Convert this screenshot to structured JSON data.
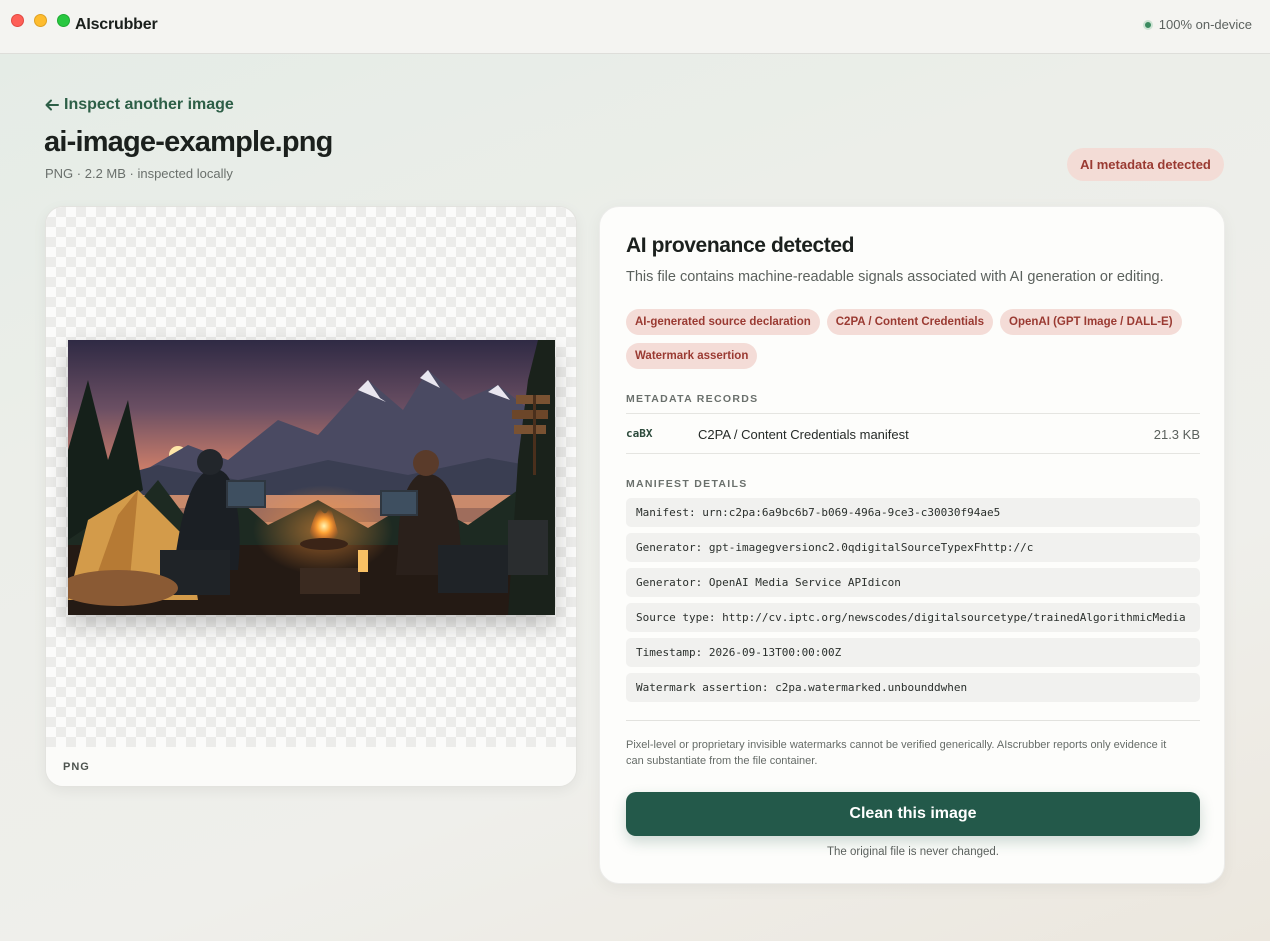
{
  "app": {
    "title": "AIscrubber",
    "status": "100% on-device"
  },
  "header": {
    "back_link": "Inspect another image",
    "back_icon": "arrow-left-icon",
    "file_name": "ai-image-example.png",
    "file_meta": "PNG · 2.2 MB · inspected locally",
    "badge": "AI metadata detected"
  },
  "preview": {
    "format_label": "PNG"
  },
  "analysis": {
    "title": "AI provenance detected",
    "subtitle": "This file contains machine-readable signals associated with AI generation or editing.",
    "chips": [
      "AI-generated source declaration",
      "C2PA / Content Credentials",
      "OpenAI (GPT Image / DALL-E)",
      "Watermark assertion"
    ],
    "records_label": "METADATA RECORDS",
    "records": [
      {
        "tag": "caBX",
        "name": "C2PA / Content Credentials manifest",
        "size": "21.3 KB"
      }
    ],
    "details_label": "MANIFEST DETAILS",
    "details": [
      "Manifest: urn:c2pa:6a9bc6b7-b069-496a-9ce3-c30030f94ae5",
      "Generator: gpt-imagegversionc2.0qdigitalSourceTypexFhttp://c",
      "Generator: OpenAI Media Service APIdicon",
      "Source type: http://cv.iptc.org/newscodes/digitalsourcetype/trainedAlgorithmicMedia",
      "Timestamp: 2026-09-13T00:00:00Z",
      "Watermark assertion: c2pa.watermarked.unbounddwhen"
    ],
    "disclaimer": "Pixel-level or proprietary invisible watermarks cannot be verified generically. AIscrubber reports only evidence it can substantiate from the file container.",
    "clean_button": "Clean this image",
    "note": "The original file is never changed."
  },
  "colors": {
    "accent": "#23594a",
    "warning_bg": "#f4dcd7",
    "warning_text": "#9a3a32",
    "status_dot": "#3a8a5f"
  }
}
